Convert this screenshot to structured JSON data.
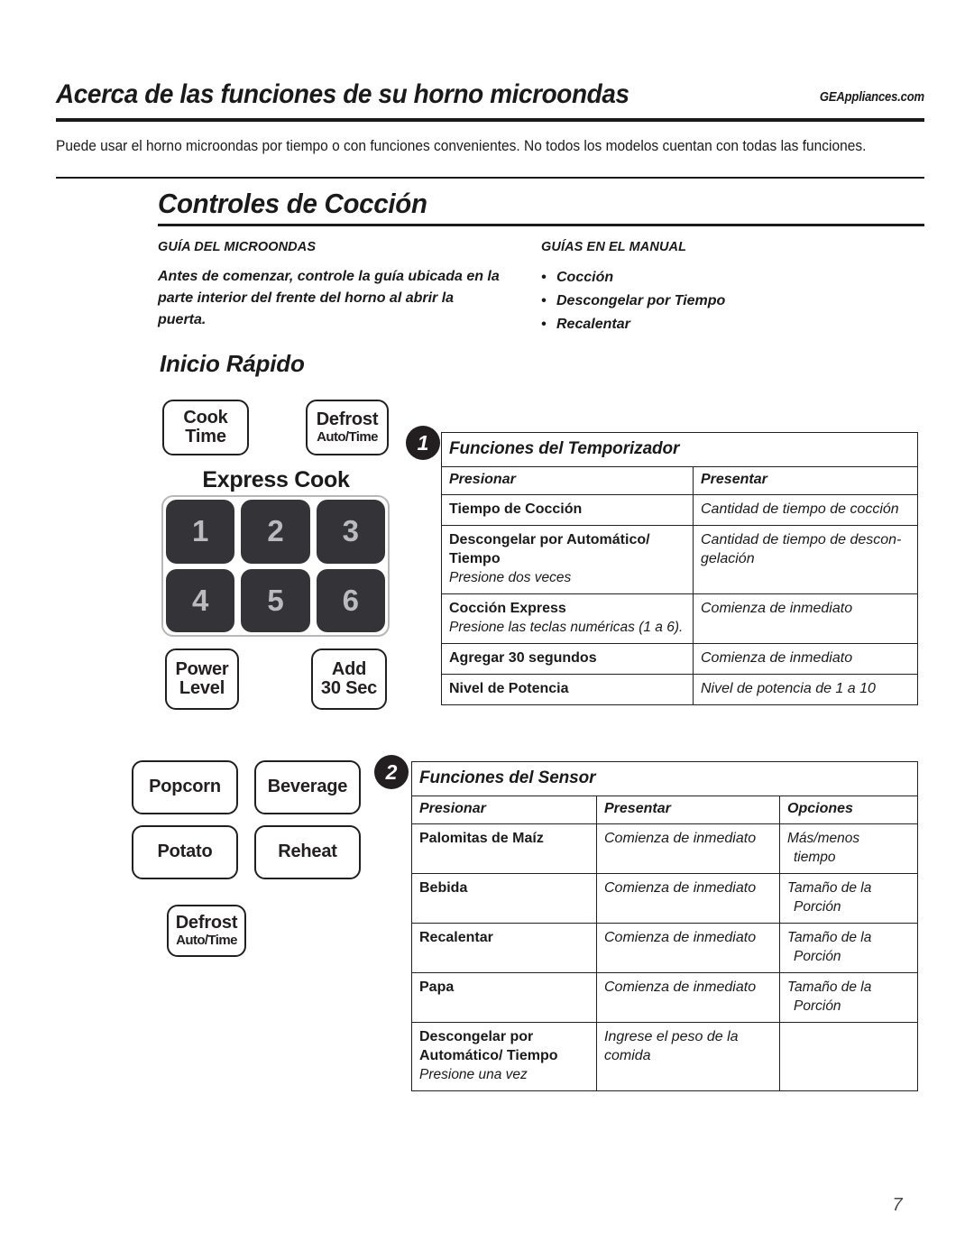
{
  "header": {
    "title": "Acerca de las funciones de su horno microondas",
    "site": "GEAppliances.com"
  },
  "intro": {
    "text": "Puede usar el horno microondas por tiempo o con funciones convenientes. No todos los modelos cuentan con todas las funciones."
  },
  "section": {
    "heading": "Controles de Cocción"
  },
  "guides": {
    "left": {
      "heading": "GUÍA DEL MICROONDAS",
      "body": "Antes de comenzar, controle la guía ubicada en la parte interior del frente del horno al abrir la puerta."
    },
    "right": {
      "heading": "GUÍAS EN EL MANUAL",
      "items": [
        "Cocción",
        "Descongelar por Tiempo",
        "Recalentar"
      ]
    }
  },
  "quickstart": {
    "heading": "Inicio Rápido",
    "express_label": "Express Cook",
    "keypad_digits": [
      "1",
      "2",
      "3",
      "4",
      "5",
      "6"
    ],
    "buttons": {
      "cook_time": {
        "main": "Cook",
        "sub": "Time"
      },
      "defrost_top": {
        "main": "Defrost",
        "sub": "Auto/Time"
      },
      "power_level": {
        "main": "Power",
        "sub": "Level"
      },
      "add_30_sec": {
        "main": "Add",
        "sub": "30 Sec"
      },
      "popcorn": {
        "main": "Popcorn"
      },
      "beverage": {
        "main": "Beverage"
      },
      "potato": {
        "main": "Potato"
      },
      "reheat": {
        "main": "Reheat"
      },
      "defrost_bottom": {
        "main": "Defrost",
        "sub": "Auto/Time"
      }
    }
  },
  "badges": {
    "one": "1",
    "two": "2"
  },
  "table_timer": {
    "title": "Funciones del Temporizador",
    "columns": [
      "Presionar",
      "Presentar"
    ],
    "rows": [
      {
        "press": "Tiempo de Cocción",
        "press_sub": "",
        "show": "Cantidad de tiempo de cocción"
      },
      {
        "press": "Descongelar por Automático/ Tiempo",
        "press_sub": "Presione dos veces",
        "show": "Cantidad de tiempo de descon-gelación"
      },
      {
        "press": "Cocción Express",
        "press_sub": "Presione las teclas numéricas (1 a 6).",
        "show": "Comienza de inmediato"
      },
      {
        "press": "Agregar 30 segundos",
        "press_sub": "",
        "show": "Comienza de inmediato"
      },
      {
        "press": "Nivel de Potencia",
        "press_sub": "",
        "show": "Nivel de potencia de 1 a 10"
      }
    ]
  },
  "table_sensor": {
    "title": "Funciones del Sensor",
    "columns": [
      "Presionar",
      "Presentar",
      "Opciones"
    ],
    "rows": [
      {
        "press": "Palomitas de Maíz",
        "press_sub": "",
        "show": "Comienza de inmediato",
        "opt": "Más/menos",
        "opt_cont": "tiempo"
      },
      {
        "press": "Bebida",
        "press_sub": "",
        "show": "Comienza de inmediato",
        "opt": "Tamaño de la",
        "opt_cont": "Porción"
      },
      {
        "press": "Recalentar",
        "press_sub": "",
        "show": "Comienza de inmediato",
        "opt": "Tamaño de la",
        "opt_cont": "Porción"
      },
      {
        "press": "Papa",
        "press_sub": "",
        "show": "Comienza de inmediato",
        "opt": "Tamaño de la",
        "opt_cont": "Porción"
      },
      {
        "press": "Descongelar por Automático/ Tiempo",
        "press_sub": "Presione una vez",
        "show": "Ingrese el peso de la comida",
        "opt": "",
        "opt_cont": ""
      }
    ]
  },
  "footer": {
    "page_number": "7"
  }
}
